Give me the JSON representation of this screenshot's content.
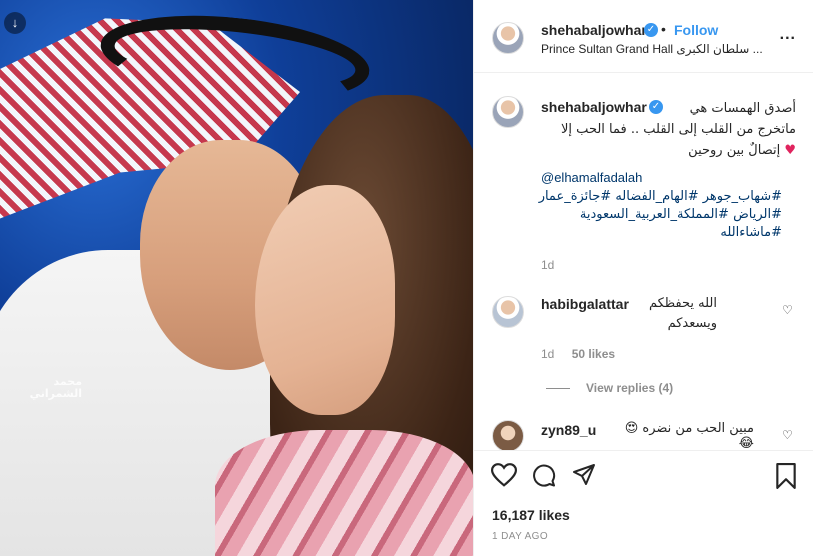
{
  "post": {
    "photo_watermark": "محمد الشمراني",
    "download_icon": "download-icon"
  },
  "header": {
    "username": "shehabaljowhar",
    "follow_label": "Follow",
    "separator": "•",
    "location": "Prince Sultan Grand Hall سلطان الكبرى ...",
    "more_label": "..."
  },
  "caption": {
    "username": "shehabaljowhar",
    "line1": "أصدق الهمسات هي",
    "line2": "ماتخرج من القلب إلى القلب .. فما الحب إلا",
    "line3": "إتصالٌ بين روحين",
    "heart": "♥",
    "mention": "@elhamalfadalah",
    "tags_line1": "#شهاب_جوهر #الهام_الفضاله #جائزة_عمار",
    "tags_line2": "#الرياض #المملكة_العربية_السعودية",
    "tags_line3": "#ماشاءالله",
    "age": "1d"
  },
  "comments": [
    {
      "username": "habibgalattar",
      "text_line1": "الله يحفظكم",
      "text_line2": "ويسعدكم",
      "age": "1d",
      "likes": "50 likes",
      "view_replies": "View replies (4)"
    },
    {
      "username": "zyn89_u",
      "text": "مبين الحب من نضره 😍😂"
    }
  ],
  "actions": {
    "likes_count": "16,187 likes",
    "posted_time": "1 DAY AGO"
  },
  "colors": {
    "accent": "#3897f0",
    "link": "#00376b",
    "muted": "#8e8e8e",
    "heart": "#e0245e"
  }
}
